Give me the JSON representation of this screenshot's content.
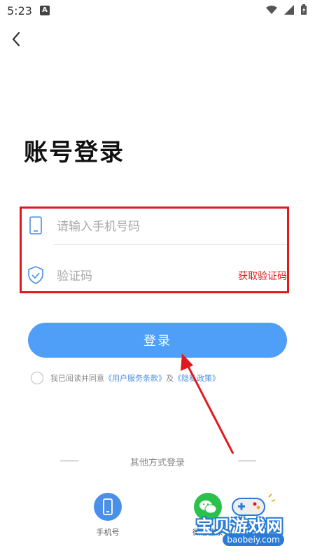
{
  "status_bar": {
    "time": "5:23",
    "badge": "A"
  },
  "header": {
    "back_icon": "chevron-left-icon"
  },
  "page": {
    "title": "账号登录"
  },
  "form": {
    "phone_placeholder": "请输入手机号码",
    "code_placeholder": "验证码",
    "get_code_label": "获取验证码",
    "highlight_color": "#e0191e"
  },
  "login": {
    "label": "登录",
    "color": "#4f9ef7"
  },
  "agreement": {
    "prefix": "我已阅读并同意",
    "terms": "《用户服务条款》",
    "and": "及",
    "privacy": "《隐私政策》"
  },
  "other_login": {
    "title": "其他方式登录",
    "options": [
      {
        "label": "手机号",
        "icon": "phone-icon",
        "color": "#4a8fe8"
      },
      {
        "label": "微信登录",
        "icon": "wechat-icon",
        "color": "#2bc24c"
      }
    ]
  },
  "watermark": {
    "title": "宝贝游戏网",
    "domain": "baobeiy.com"
  }
}
